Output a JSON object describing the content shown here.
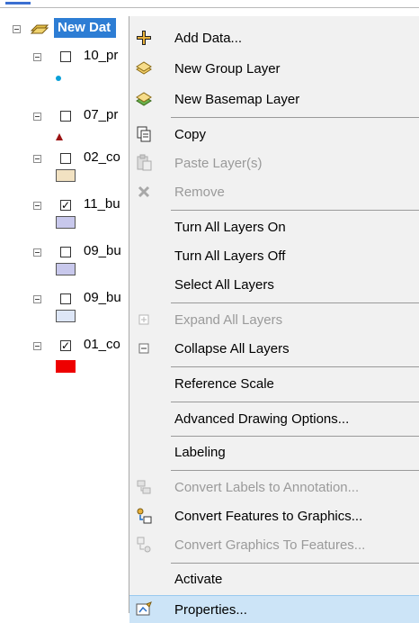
{
  "toc": {
    "data_frame_label": "New Dat",
    "layers": [
      {
        "label": "10_pr",
        "checked": false,
        "symbol": "point",
        "color": "#0aa0d8"
      },
      {
        "label": "07_pr",
        "checked": false,
        "symbol": "triangle",
        "color": "#9b1212"
      },
      {
        "label": "02_co",
        "checked": false,
        "symbol": "polygon",
        "color": "#f2e2c2"
      },
      {
        "label": "11_bu",
        "checked": true,
        "symbol": "polygon",
        "color": "#c8c8ec"
      },
      {
        "label": "09_bu",
        "checked": false,
        "symbol": "polygon",
        "color": "#c8c8ec"
      },
      {
        "label": "09_bu",
        "checked": false,
        "symbol": "polygon",
        "color": "#dde6f7"
      },
      {
        "label": "01_co",
        "checked": true,
        "symbol": "polygon",
        "color": "#ee0000"
      }
    ],
    "checkmark": "✓"
  },
  "menu": {
    "items": [
      {
        "label": "Add Data...",
        "icon": "add-icon",
        "enabled": true
      },
      {
        "label": "New Group Layer",
        "icon": "group-layer-icon",
        "enabled": true
      },
      {
        "label": "New Basemap Layer",
        "icon": "basemap-layer-icon",
        "enabled": true
      },
      {
        "label": "Copy",
        "icon": "copy-icon",
        "enabled": true
      },
      {
        "label": "Paste Layer(s)",
        "icon": "paste-icon",
        "enabled": false
      },
      {
        "label": "Remove",
        "icon": "remove-icon",
        "enabled": false
      },
      {
        "label": "Turn All Layers On",
        "icon": "",
        "enabled": true
      },
      {
        "label": "Turn All Layers Off",
        "icon": "",
        "enabled": true
      },
      {
        "label": "Select All Layers",
        "icon": "",
        "enabled": true
      },
      {
        "label": "Expand All Layers",
        "icon": "expand-icon",
        "enabled": false
      },
      {
        "label": "Collapse All Layers",
        "icon": "collapse-icon",
        "enabled": true
      },
      {
        "label": "Reference Scale",
        "icon": "",
        "enabled": true
      },
      {
        "label": "Advanced Drawing Options...",
        "icon": "",
        "enabled": true
      },
      {
        "label": "Labeling",
        "icon": "",
        "enabled": true
      },
      {
        "label": "Convert Labels to Annotation...",
        "icon": "convert-labels-icon",
        "enabled": false
      },
      {
        "label": "Convert Features to Graphics...",
        "icon": "convert-features-icon",
        "enabled": true
      },
      {
        "label": "Convert Graphics To Features...",
        "icon": "convert-graphics-icon",
        "enabled": false
      },
      {
        "label": "Activate",
        "icon": "",
        "enabled": true
      },
      {
        "label": "Properties...",
        "icon": "properties-icon",
        "enabled": true,
        "highlighted": true
      }
    ]
  },
  "colors": {
    "selection_blue": "#2d7dd4",
    "menu_bg": "#f1f1f1",
    "hover_bg": "#cce4f7",
    "disabled_text": "#9a9a9a"
  }
}
